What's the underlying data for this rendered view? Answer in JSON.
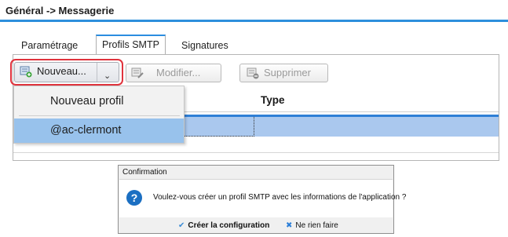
{
  "page": {
    "breadcrumb": "Général -> Messagerie"
  },
  "tabs": [
    {
      "label": "Paramétrage",
      "active": false
    },
    {
      "label": "Profils SMTP",
      "active": true
    },
    {
      "label": "Signatures",
      "active": false
    }
  ],
  "toolbar": {
    "new_label": "Nouveau...",
    "modify_label": "Modifier...",
    "delete_label": "Supprimer"
  },
  "dropdown": {
    "items": [
      {
        "label": "Nouveau profil",
        "selected": false
      },
      {
        "label": "@ac-clermont",
        "selected": true
      }
    ]
  },
  "grid": {
    "columns": [
      "Type"
    ]
  },
  "dialog": {
    "title": "Confirmation",
    "message": "Voulez-vous créer un profil SMTP avec les informations de l'application ?",
    "confirm_label": "Créer la configuration",
    "cancel_label": "Ne rien faire"
  },
  "colors": {
    "accent": "#2d8fdc",
    "highlight_outline": "#e0333d",
    "selection": "#98c2ec"
  }
}
